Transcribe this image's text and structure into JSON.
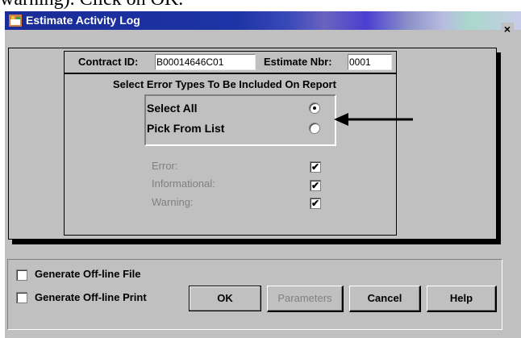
{
  "document_text": "warning).  Click on OK.",
  "window": {
    "title": "Estimate Activity Log",
    "close_label": "×"
  },
  "contract": {
    "contract_id_label": "Contract ID:",
    "contract_id_value": "B00014646C01",
    "estimate_nbr_label": "Estimate Nbr:",
    "estimate_nbr_value": "0001"
  },
  "error_types": {
    "heading": "Select Error Types To Be Included On Report",
    "options": [
      {
        "label": "Select All",
        "selected": true
      },
      {
        "label": "Pick From List",
        "selected": false
      }
    ],
    "types": [
      {
        "label": "Error:",
        "checked": true
      },
      {
        "label": "Informational:",
        "checked": true
      },
      {
        "label": "Warning:",
        "checked": true
      }
    ]
  },
  "bottom": {
    "generate_file_label": "Generate Off-line File",
    "generate_print_label": "Generate Off-line Print",
    "buttons": {
      "ok": "OK",
      "parameters": "Parameters",
      "cancel": "Cancel",
      "help": "Help"
    }
  },
  "icons": {
    "app": "app-icon",
    "arrow": "arrow-left-icon"
  }
}
